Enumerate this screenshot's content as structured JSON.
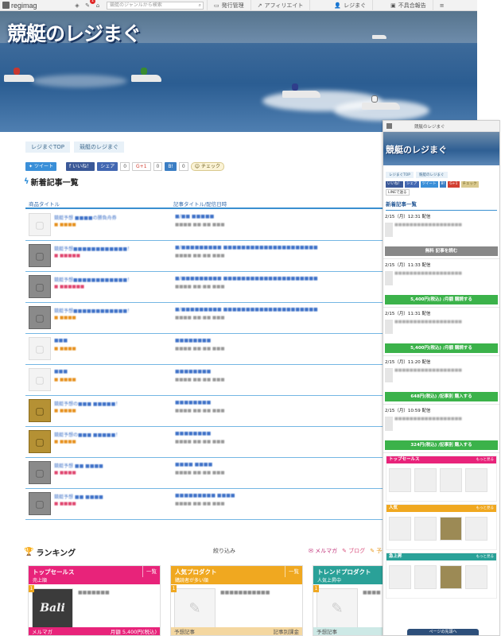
{
  "topbar": {
    "logo": "regimag",
    "notif_count": "1",
    "search_placeholder": "競艇のジャンルから検索",
    "nav": [
      "発行管理",
      "アフィリエイト",
      "レジまぐ",
      "不具合報告"
    ]
  },
  "hero": {
    "title": "競艇のレジまぐ"
  },
  "breadcrumbs": [
    "レジまぐTOP",
    "競艇のレジまぐ"
  ],
  "share": {
    "tweet": "ツイート",
    "like": "いいね！",
    "share": "シェア",
    "share_count": "0",
    "gplus": "G+1",
    "gplus_count": "0",
    "hatena": "B!",
    "hatena_count": "0",
    "check": "チェック"
  },
  "new_articles": {
    "title": "新着記事一覧",
    "col_product": "商品タイトル",
    "col_article": "記事タイトル/配信日時",
    "rows": [
      {
        "thumb": "light",
        "product": "競艇予想 ■■■■の勝負舟券",
        "cat": "■ ■■■■",
        "cat_color": "orange",
        "article": "■/■■ ■■■■■",
        "date": "■■■■ ■■:■■ ■■■"
      },
      {
        "thumb": "dark",
        "product": "競艇予想■■■■■■■■■■■■！",
        "cat": "■ ■■■■■",
        "cat_color": "red",
        "article": "■/■■■■■■■■■ ■■■■■■■■■■■■■■■■■■■■■",
        "date": "■■■■ ■■:■■ ■■■"
      },
      {
        "thumb": "dark",
        "product": "競艇予想■■■■■■■■■■■■！",
        "cat": "■ ■■■■■■",
        "cat_color": "red",
        "article": "■/■■■■■■■■■ ■■■■■■■■■■■■■■■■■■■■■",
        "date": "■■■■ ■■:■■ ■■■"
      },
      {
        "thumb": "dark",
        "product": "競艇予想■■■■■■■■■■■■！",
        "cat": "■ ■■■■",
        "cat_color": "orange",
        "article": "■/■■■■■■■■■ ■■■■■■■■■■■■■■■■■■■■■",
        "date": "■■■■ ■■:■■ ■■■"
      },
      {
        "thumb": "light",
        "product": "■■■",
        "cat": "■ ■■■■",
        "cat_color": "orange",
        "article": "■■■■■■■■",
        "date": "■■■■ ■■:■■ ■■■"
      },
      {
        "thumb": "light",
        "product": "■■■",
        "cat": "■ ■■■■",
        "cat_color": "orange",
        "article": "■■■■■■■■",
        "date": "■■■■ ■■:■■ ■■■"
      },
      {
        "thumb": "gold",
        "product": "競艇予想の■■■ ■■■■■！",
        "cat": "■ ■■■■",
        "cat_color": "orange",
        "article": "■■■■■■■■",
        "date": "■■■■ ■■:■■ ■■■"
      },
      {
        "thumb": "gold",
        "product": "競艇予想の■■■ ■■■■■！",
        "cat": "■ ■■■■",
        "cat_color": "orange",
        "article": "■■■■■■■■",
        "date": "■■■■ ■■:■■ ■■■"
      },
      {
        "thumb": "dark",
        "product": "競艇予想 ■■ ■■■■",
        "cat": "■ ■■■■",
        "cat_color": "red",
        "article": "■■■■ ■■■■",
        "date": "■■■■ ■■:■■ ■■■"
      },
      {
        "thumb": "dark",
        "product": "競艇予想 ■■ ■■■■",
        "cat": "■ ■■■■",
        "cat_color": "red",
        "article": "■■■■■■■■■ ■■■■",
        "date": "■■■■ ■■:■■ ■■■"
      }
    ]
  },
  "ranking": {
    "title": "ランキング",
    "filter": "絞り込み",
    "tabs": [
      "メルマガ",
      "ブログ",
      "予想"
    ],
    "cards": [
      {
        "title": "トップセールス",
        "sub": "売上順",
        "all": "一覧",
        "color": "#e8237a",
        "thumb": "Bali",
        "rank": "1",
        "text": "■■■■■■■",
        "footer_left": "メルマガ",
        "footer_right": "月額 5,400円(税込)",
        "footer_color": "#e8237a"
      },
      {
        "title": "人気プロダクト",
        "sub": "購読者が多い順",
        "all": "一覧",
        "color": "#f0a820",
        "thumb": "",
        "rank": "1",
        "text": "■■■■■■■■■■■",
        "footer_left": "予想記事",
        "footer_right": "記事別課金",
        "footer_color": "#f4d7a0"
      },
      {
        "title": "トレンドプロダクト",
        "sub": "人気上昇中",
        "all": "",
        "color": "#2aa198",
        "thumb": "",
        "rank": "1",
        "text": "■■■■",
        "footer_left": "予想記事",
        "footer_right": "",
        "footer_color": "#cde9e6"
      }
    ]
  },
  "mobile": {
    "top": "競艇のレジまぐ",
    "hero": "競艇のレジまぐ",
    "crumbs": [
      "レジまぐTOP",
      "競艇のレジまぐ"
    ],
    "shares": [
      "いいね！",
      "シェア",
      "ツイート",
      "B!",
      "G+1",
      "チェック",
      "LINEで送る"
    ],
    "section": "新着記事一覧",
    "items": [
      {
        "date": "2/15（月）12:31 配信",
        "btn": "無料 記事を読む",
        "btn_type": "gray"
      },
      {
        "date": "2/15（月）11:33 配信",
        "btn": "5,400円(税込) /月額 購読する",
        "btn_type": "green"
      },
      {
        "date": "2/15（月）11:31 配信",
        "btn": "5,400円(税込) /月額 購読する",
        "btn_type": "green"
      },
      {
        "date": "2/15（月）11:20 配信",
        "btn": "648円(税込) /記事別 購入する",
        "btn_type": "green"
      },
      {
        "date": "2/15（月）10:59 配信",
        "btn": "324円(税込) /記事別 購入する",
        "btn_type": "green"
      }
    ],
    "ranks": [
      {
        "title": "トップセールス",
        "more": "もっと見る",
        "color": "#e8237a"
      },
      {
        "title": "人気",
        "more": "もっと見る",
        "color": "#f0a820"
      },
      {
        "title": "急上昇",
        "more": "もっと見る",
        "color": "#2aa198"
      }
    ],
    "bottom": "ページの先頭へ"
  }
}
